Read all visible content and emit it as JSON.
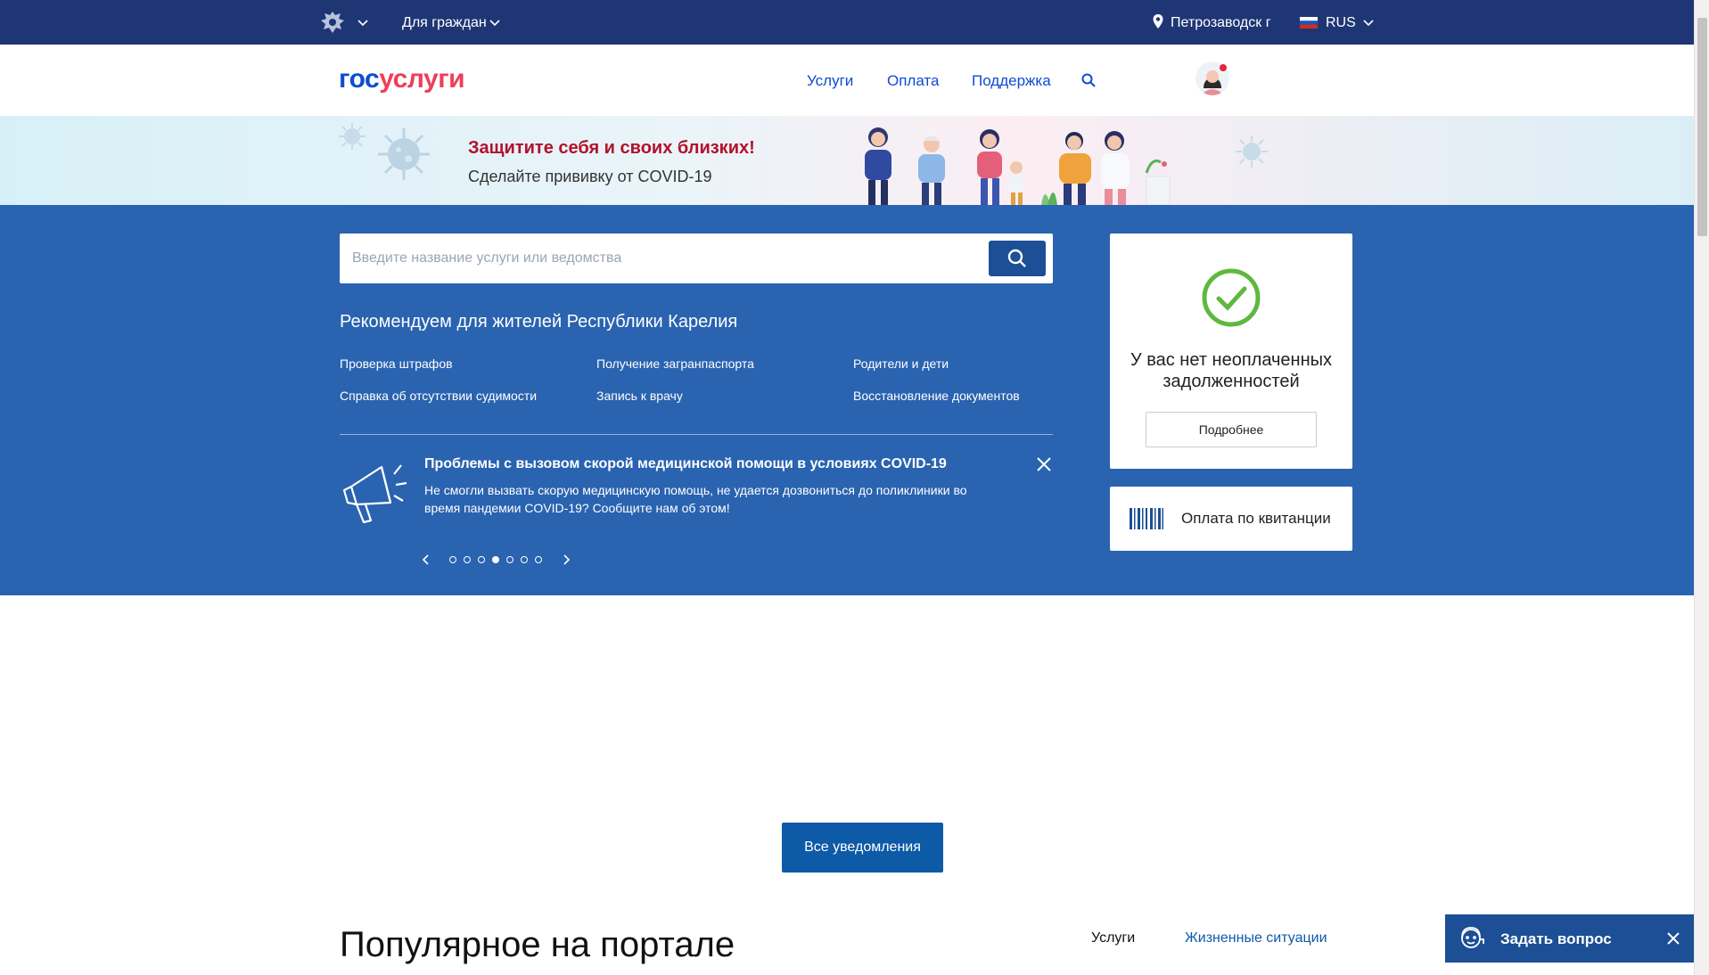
{
  "topbar": {
    "role_label": "Для граждан",
    "city": "Петрозаводск г",
    "language": "RUS"
  },
  "header": {
    "logo_part1": "гос",
    "logo_part2": "услуги",
    "nav": [
      "Услуги",
      "Оплата",
      "Поддержка"
    ]
  },
  "banner": {
    "title": "Защитите себя и своих близких!",
    "subtitle": "Сделайте прививку от COVID-19"
  },
  "search": {
    "placeholder": "Введите название услуги или ведомства"
  },
  "recommend": {
    "title": "Рекомендуем для жителей Республики Карелия",
    "links": [
      "Проверка штрафов",
      "Получение загранпаспорта",
      "Родители и дети",
      "Справка об отсутствии судимости",
      "Запись к врачу",
      "Восстановление документов"
    ]
  },
  "news": {
    "title": "Проблемы с вызовом скорой медицинской помощи в условиях COVID-19",
    "text": "Не смогли вызвать скорую медицинскую помощь, не удается дозвониться до поликлиники во время пандемии COVID-19? Сообщите нам об этом!",
    "slide_count": 7,
    "active_slide": 4
  },
  "debt": {
    "text": "У вас нет неоплаченных задолженностей",
    "button": "Подробнее"
  },
  "payment": {
    "label": "Оплата по квитанции"
  },
  "notifications": {
    "all_button": "Все уведомления"
  },
  "popular": {
    "title": "Популярное на портале",
    "tab_services": "Услуги",
    "tab_life": "Жизненные ситуации"
  },
  "ask": {
    "label": "Задать вопрос"
  },
  "colors": {
    "topbar": "#1f3675",
    "main_blue": "#2a63b0",
    "link_blue": "#0d4cd3",
    "accent_red": "#ee3f58",
    "check_green": "#5fb83e"
  }
}
